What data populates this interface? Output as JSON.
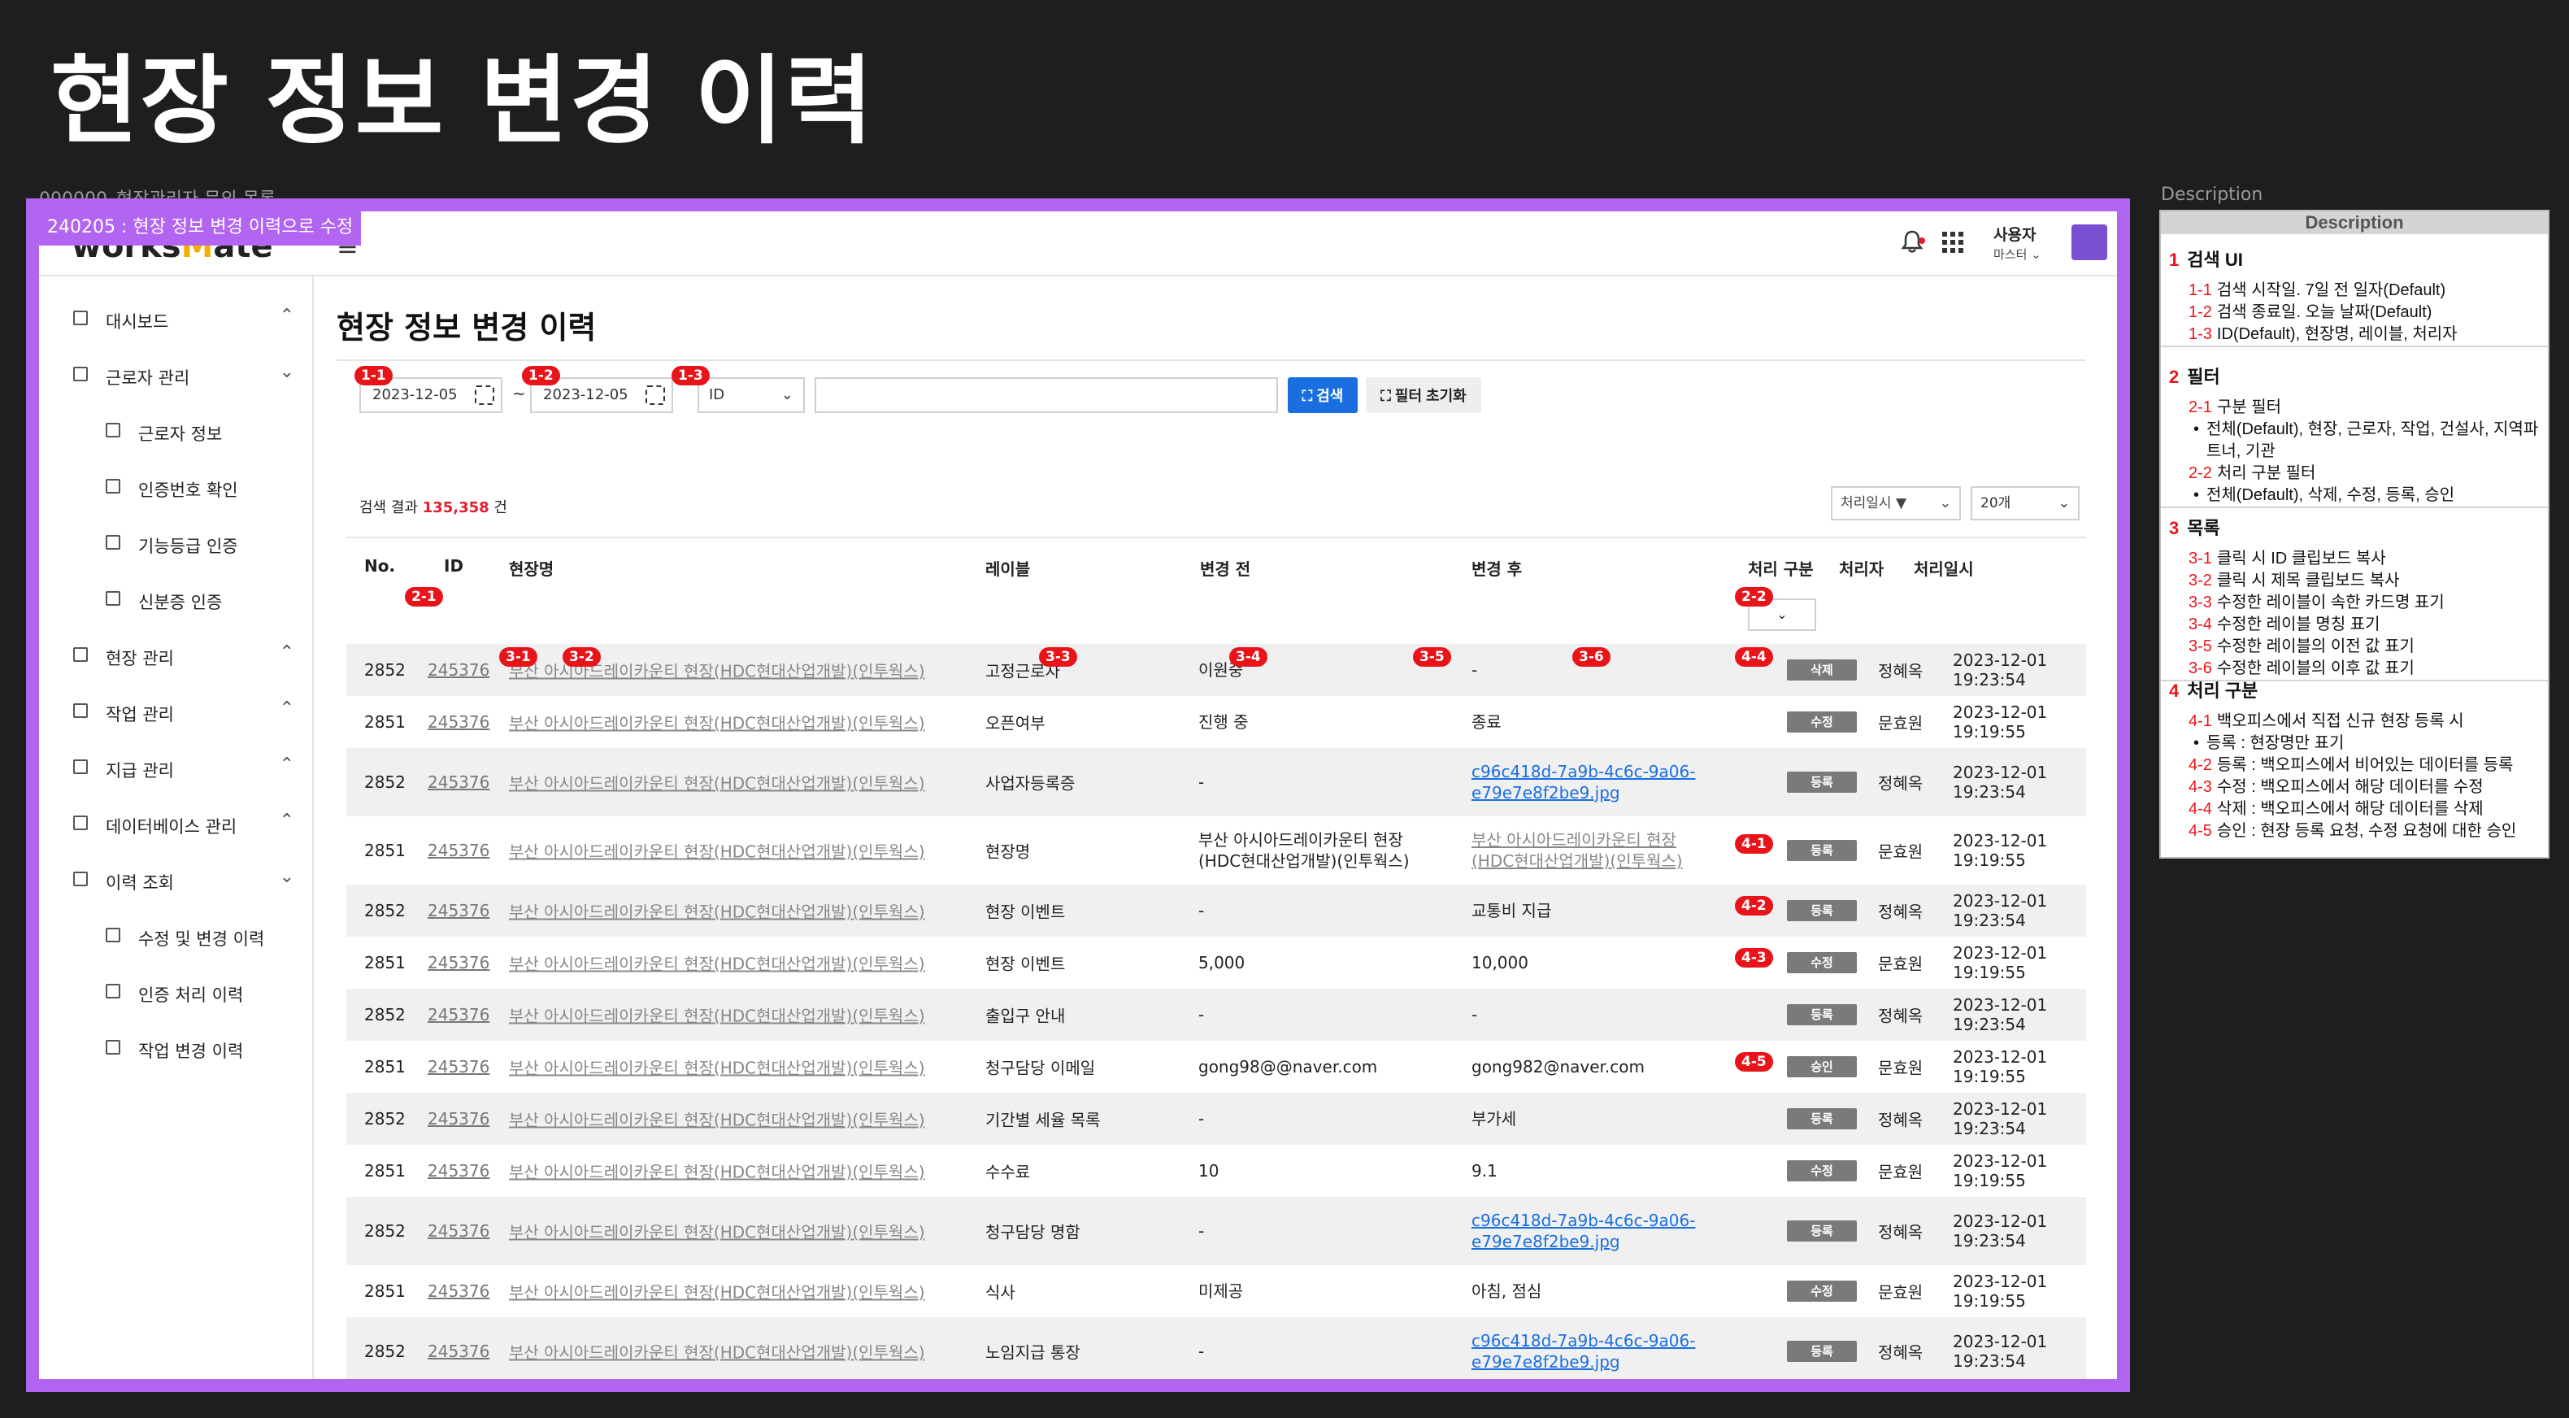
{
  "page_title": "현장 정보 변경 이력",
  "frame_label": "000000_현장관리자 문의 목록",
  "version_tag": "240205 : 현장 정보 변경 이력으로 수정",
  "description_label": "Description",
  "header": {
    "logo_prefix": "works",
    "logo_accent": "M",
    "logo_suffix": "ate",
    "hamburger_icon": "≡",
    "bell_icon": "🔔",
    "apps_icon": "⋮⋮⋮",
    "user_name": "사용자",
    "user_role": "마스터 ⌄",
    "avatar_color": "#7b4fd1"
  },
  "sidebar": {
    "items": [
      {
        "label": "대시보드",
        "level": 1,
        "chevron": "⌃"
      },
      {
        "label": "근로자 관리",
        "level": 1,
        "chevron": "⌄"
      },
      {
        "label": "근로자 정보",
        "level": 2,
        "chevron": ""
      },
      {
        "label": "인증번호 확인",
        "level": 2,
        "chevron": ""
      },
      {
        "label": "기능등급 인증",
        "level": 2,
        "chevron": ""
      },
      {
        "label": "신분증 인증",
        "level": 2,
        "chevron": ""
      },
      {
        "label": "현장 관리",
        "level": 1,
        "chevron": "⌃"
      },
      {
        "label": "작업 관리",
        "level": 1,
        "chevron": "⌃"
      },
      {
        "label": "지급 관리",
        "level": 1,
        "chevron": "⌃"
      },
      {
        "label": "데이터베이스 관리",
        "level": 1,
        "chevron": "⌃"
      },
      {
        "label": "이력 조회",
        "level": 1,
        "chevron": "⌄"
      },
      {
        "label": "수정 및 변경 이력",
        "level": 2,
        "chevron": ""
      },
      {
        "label": "인증 처리 이력",
        "level": 2,
        "chevron": ""
      },
      {
        "label": "작업 변경 이력",
        "level": 2,
        "chevron": ""
      }
    ]
  },
  "main": {
    "title": "현장 정보 변경 이력",
    "search": {
      "start_date": "2023-12-05",
      "end_date": "2023-12-05",
      "tilde": "~",
      "field_select": "ID",
      "keyword_value": "",
      "search_button": "검색",
      "reset_button": "필터 초기화"
    },
    "result": {
      "prefix": "검색 결과",
      "count": "135,358",
      "suffix": "건",
      "sort_select": "처리일시 ▼",
      "page_size_select": "20개"
    },
    "columns": {
      "no": "No.",
      "id": "ID",
      "site": "현장명",
      "label": "레이블",
      "before": "변경 전",
      "after": "변경 후",
      "type": "처리 구분",
      "person": "처리자",
      "date": "처리일시"
    },
    "rows": [
      {
        "no": "2852",
        "id": "245376",
        "site": "부산 아시아드레이카운티 현장(HDC현대산업개발)(인투웍스)",
        "label": "고정근로자",
        "before": "이원중",
        "after": "-",
        "after_style": "plain",
        "type": "삭제",
        "person": "정혜옥",
        "date": "2023-12-01 19:23:54"
      },
      {
        "no": "2851",
        "id": "245376",
        "site": "부산 아시아드레이카운티 현장(HDC현대산업개발)(인투웍스)",
        "label": "오픈여부",
        "before": "진행 중",
        "after": "종료",
        "after_style": "plain",
        "type": "수정",
        "person": "문효원",
        "date": "2023-12-01 19:19:55"
      },
      {
        "no": "2852",
        "id": "245376",
        "site": "부산 아시아드레이카운티 현장(HDC현대산업개발)(인투웍스)",
        "label": "사업자등록증",
        "before": "-",
        "after": "c96c418d-7a9b-4c6c-9a06-\ne79e7e8f2be9.jpg",
        "after_style": "link",
        "type": "등록",
        "person": "정혜옥",
        "date": "2023-12-01 19:23:54"
      },
      {
        "no": "2851",
        "id": "245376",
        "site": "부산 아시아드레이카운티 현장(HDC현대산업개발)(인투웍스)",
        "label": "현장명",
        "before": "부산 아시아드레이카운티 현장\n(HDC현대산업개발)(인투웍스)",
        "after": "부산 아시아드레이카운티 현장\n(HDC현대산업개발)(인투웍스)",
        "after_style": "gray",
        "type": "등록",
        "person": "문효원",
        "date": "2023-12-01 19:19:55"
      },
      {
        "no": "2852",
        "id": "245376",
        "site": "부산 아시아드레이카운티 현장(HDC현대산업개발)(인투웍스)",
        "label": "현장 이벤트",
        "before": "-",
        "after": "교통비 지급",
        "after_style": "plain",
        "type": "등록",
        "person": "정혜옥",
        "date": "2023-12-01 19:23:54"
      },
      {
        "no": "2851",
        "id": "245376",
        "site": "부산 아시아드레이카운티 현장(HDC현대산업개발)(인투웍스)",
        "label": "현장 이벤트",
        "before": "5,000",
        "after": "10,000",
        "after_style": "plain",
        "type": "수정",
        "person": "문효원",
        "date": "2023-12-01 19:19:55"
      },
      {
        "no": "2852",
        "id": "245376",
        "site": "부산 아시아드레이카운티 현장(HDC현대산업개발)(인투웍스)",
        "label": "출입구 안내",
        "before": "-",
        "after": "-",
        "after_style": "plain",
        "type": "등록",
        "person": "정혜옥",
        "date": "2023-12-01 19:23:54"
      },
      {
        "no": "2851",
        "id": "245376",
        "site": "부산 아시아드레이카운티 현장(HDC현대산업개발)(인투웍스)",
        "label": "청구담당 이메일",
        "before": "gong98@@naver.com",
        "after": "gong982@naver.com",
        "after_style": "plain",
        "type": "승인",
        "person": "문효원",
        "date": "2023-12-01 19:19:55"
      },
      {
        "no": "2852",
        "id": "245376",
        "site": "부산 아시아드레이카운티 현장(HDC현대산업개발)(인투웍스)",
        "label": "기간별 세율 목록",
        "before": "-",
        "after": "부가세",
        "after_style": "plain",
        "type": "등록",
        "person": "정혜옥",
        "date": "2023-12-01 19:23:54"
      },
      {
        "no": "2851",
        "id": "245376",
        "site": "부산 아시아드레이카운티 현장(HDC현대산업개발)(인투웍스)",
        "label": "수수료",
        "before": "10",
        "after": "9.1",
        "after_style": "plain",
        "type": "수정",
        "person": "문효원",
        "date": "2023-12-01 19:19:55"
      },
      {
        "no": "2852",
        "id": "245376",
        "site": "부산 아시아드레이카운티 현장(HDC현대산업개발)(인투웍스)",
        "label": "청구담당 명함",
        "before": "-",
        "after": "c96c418d-7a9b-4c6c-9a06-\ne79e7e8f2be9.jpg",
        "after_style": "link",
        "type": "등록",
        "person": "정혜옥",
        "date": "2023-12-01 19:23:54"
      },
      {
        "no": "2851",
        "id": "245376",
        "site": "부산 아시아드레이카운티 현장(HDC현대산업개발)(인투웍스)",
        "label": "식사",
        "before": "미제공",
        "after": "아침, 점심",
        "after_style": "plain",
        "type": "수정",
        "person": "문효원",
        "date": "2023-12-01 19:19:55"
      },
      {
        "no": "2852",
        "id": "245376",
        "site": "부산 아시아드레이카운티 현장(HDC현대산업개발)(인투웍스)",
        "label": "노임지급 통장",
        "before": "-",
        "after": "c96c418d-7a9b-4c6c-9a06-\ne79e7e8f2be9.jpg",
        "after_style": "link",
        "type": "등록",
        "person": "정혜옥",
        "date": "2023-12-01 19:23:54"
      }
    ]
  },
  "markers": {
    "m1_1": "1-1",
    "m1_2": "1-2",
    "m1_3": "1-3",
    "m2_1": "2-1",
    "m2_2": "2-2",
    "m3_1": "3-1",
    "m3_2": "3-2",
    "m3_3": "3-3",
    "m3_4": "3-4",
    "m3_5": "3-5",
    "m3_6": "3-6",
    "m4_4": "4-4",
    "m4_1": "4-1",
    "m4_2": "4-2",
    "m4_3": "4-3",
    "m4_5": "4-5",
    "color": "#e8141a"
  },
  "description": {
    "header": "Description",
    "sections": [
      {
        "num": "1",
        "title": "검색 UI",
        "lines": [
          {
            "num": "1-1",
            "text": "검색 시작일. 7일 전 일자(Default)"
          },
          {
            "num": "1-2",
            "text": "검색 종료일. 오늘 날짜(Default)"
          },
          {
            "num": "1-3",
            "text": "ID(Default), 현장명, 레이블, 처리자"
          }
        ]
      },
      {
        "num": "2",
        "title": "필터",
        "lines": [
          {
            "num": "2-1",
            "text": "구분 필터"
          },
          {
            "bullet": "전체(Default), 현장, 근로자, 작업, 건설사, 지역파트너, 기관"
          },
          {
            "num": "2-2",
            "text": "처리 구분 필터"
          },
          {
            "bullet": "전체(Default), 삭제, 수정, 등록, 승인"
          }
        ]
      },
      {
        "num": "3",
        "title": "목록",
        "lines": [
          {
            "num": "3-1",
            "text": "클릭 시 ID 클립보드 복사"
          },
          {
            "num": "3-2",
            "text": "클릭 시 제목 클립보드 복사"
          },
          {
            "num": "3-3",
            "text": "수정한 레이블이 속한 카드명 표기"
          },
          {
            "num": "3-4",
            "text": "수정한 레이블 명칭 표기"
          },
          {
            "num": "3-5",
            "text": "수정한 레이블의 이전 값 표기"
          },
          {
            "num": "3-6",
            "text": "수정한 레이블의 이후 값 표기"
          }
        ]
      },
      {
        "num": "4",
        "title": "처리 구분",
        "lines": [
          {
            "num": "4-1",
            "text": "백오피스에서 직접 신규 현장 등록 시"
          },
          {
            "bullet": "등록 : 현장명만 표기"
          },
          {
            "num": "4-2",
            "text": "등록 : 백오피스에서 비어있는 데이터를 등록"
          },
          {
            "num": "4-3",
            "text": "수정 : 백오피스에서 해당 데이터를 수정"
          },
          {
            "num": "4-4",
            "text": "삭제 : 백오피스에서 해당 데이터를 삭제"
          },
          {
            "num": "4-5",
            "text": "승인 : 현장 등록 요청, 수정 요청에 대한 승인"
          }
        ]
      }
    ]
  }
}
